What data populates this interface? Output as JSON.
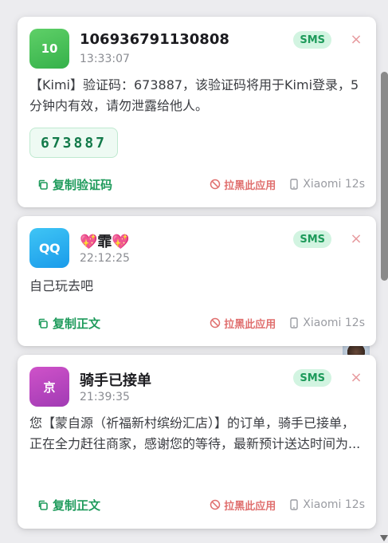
{
  "notifications": [
    {
      "icon_text": "10",
      "sender": "106936791130808",
      "time": "13:33:07",
      "badge": "SMS",
      "body": "【Kimi】验证码：673887，该验证码将用于Kimi登录，5分钟内有效，请勿泄露给他人。",
      "code": "673887",
      "copy_label": "复制验证码",
      "block_label": "拉黑此应用",
      "device": "Xiaomi 12s"
    },
    {
      "icon_text": "QQ",
      "sender": "💖霏💖",
      "time": "22:12:25",
      "badge": "SMS",
      "body": "自己玩去吧",
      "copy_label": "复制正文",
      "block_label": "拉黑此应用",
      "device": "Xiaomi 12s"
    },
    {
      "icon_text": "京",
      "sender": "骑手已接单",
      "time": "21:39:35",
      "badge": "SMS",
      "body": "您【蒙自源（祈福新村缤纷汇店）】的订单，骑手已接单，正在全力赶往商家，感谢您的等待，最新预计送达时间为...",
      "copy_label": "复制正文",
      "block_label": "拉黑此应用",
      "device": "Xiaomi 12s"
    }
  ],
  "colors": {
    "accent_green": "#1f9b5c",
    "badge_bg": "#d2f4e1",
    "danger": "#e0706f"
  },
  "icons": [
    "copy-icon",
    "block-icon",
    "phone-icon",
    "close-icon"
  ]
}
